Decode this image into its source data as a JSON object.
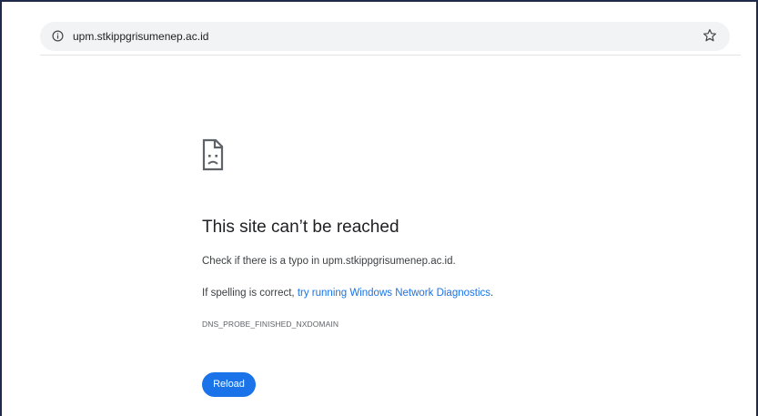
{
  "address_bar": {
    "url": "upm.stkippgrisumenep.ac.id",
    "site_info_icon": "info-icon",
    "bookmark_icon": "star-icon"
  },
  "error_page": {
    "icon": "sad-page-icon",
    "heading": "This site can’t be reached",
    "line1": "Check if there is a typo in upm.stkippgrisumenep.ac.id.",
    "line2_prefix": "If spelling is correct, ",
    "line2_link": "try running Windows Network Diagnostics",
    "line2_suffix": ".",
    "error_code": "DNS_PROBE_FINISHED_NXDOMAIN",
    "reload_label": "Reload"
  },
  "colors": {
    "accent": "#1a73e8",
    "heading": "#202124",
    "body_text": "#3c4043",
    "omnibox_bg": "#f1f3f4",
    "frame_border": "#1f2a4a"
  }
}
